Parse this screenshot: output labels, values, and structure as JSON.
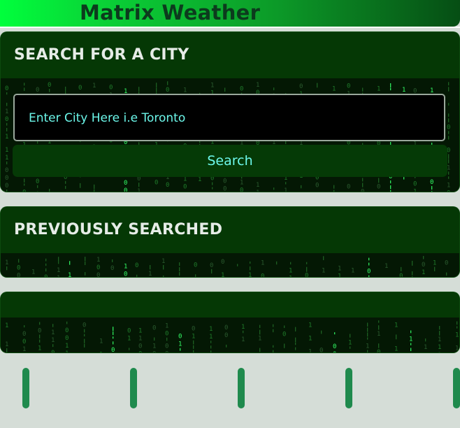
{
  "app": {
    "title": "Matrix Weather"
  },
  "search_section": {
    "title": "SEARCH FOR A CITY",
    "input_value": "Enter City Here i.e Toronto",
    "button_label": "Search"
  },
  "history_section": {
    "title": "PREVIOUSLY SEARCHED",
    "items": []
  },
  "current_weather": {
    "title": ""
  },
  "forecast": {
    "cards": [
      "",
      "",
      "",
      "",
      ""
    ]
  },
  "colors": {
    "accent_text": "#6cf7ea",
    "card_header": "#053805",
    "background": "#d5ddd7",
    "forecast_pill": "#1f8a4d"
  }
}
